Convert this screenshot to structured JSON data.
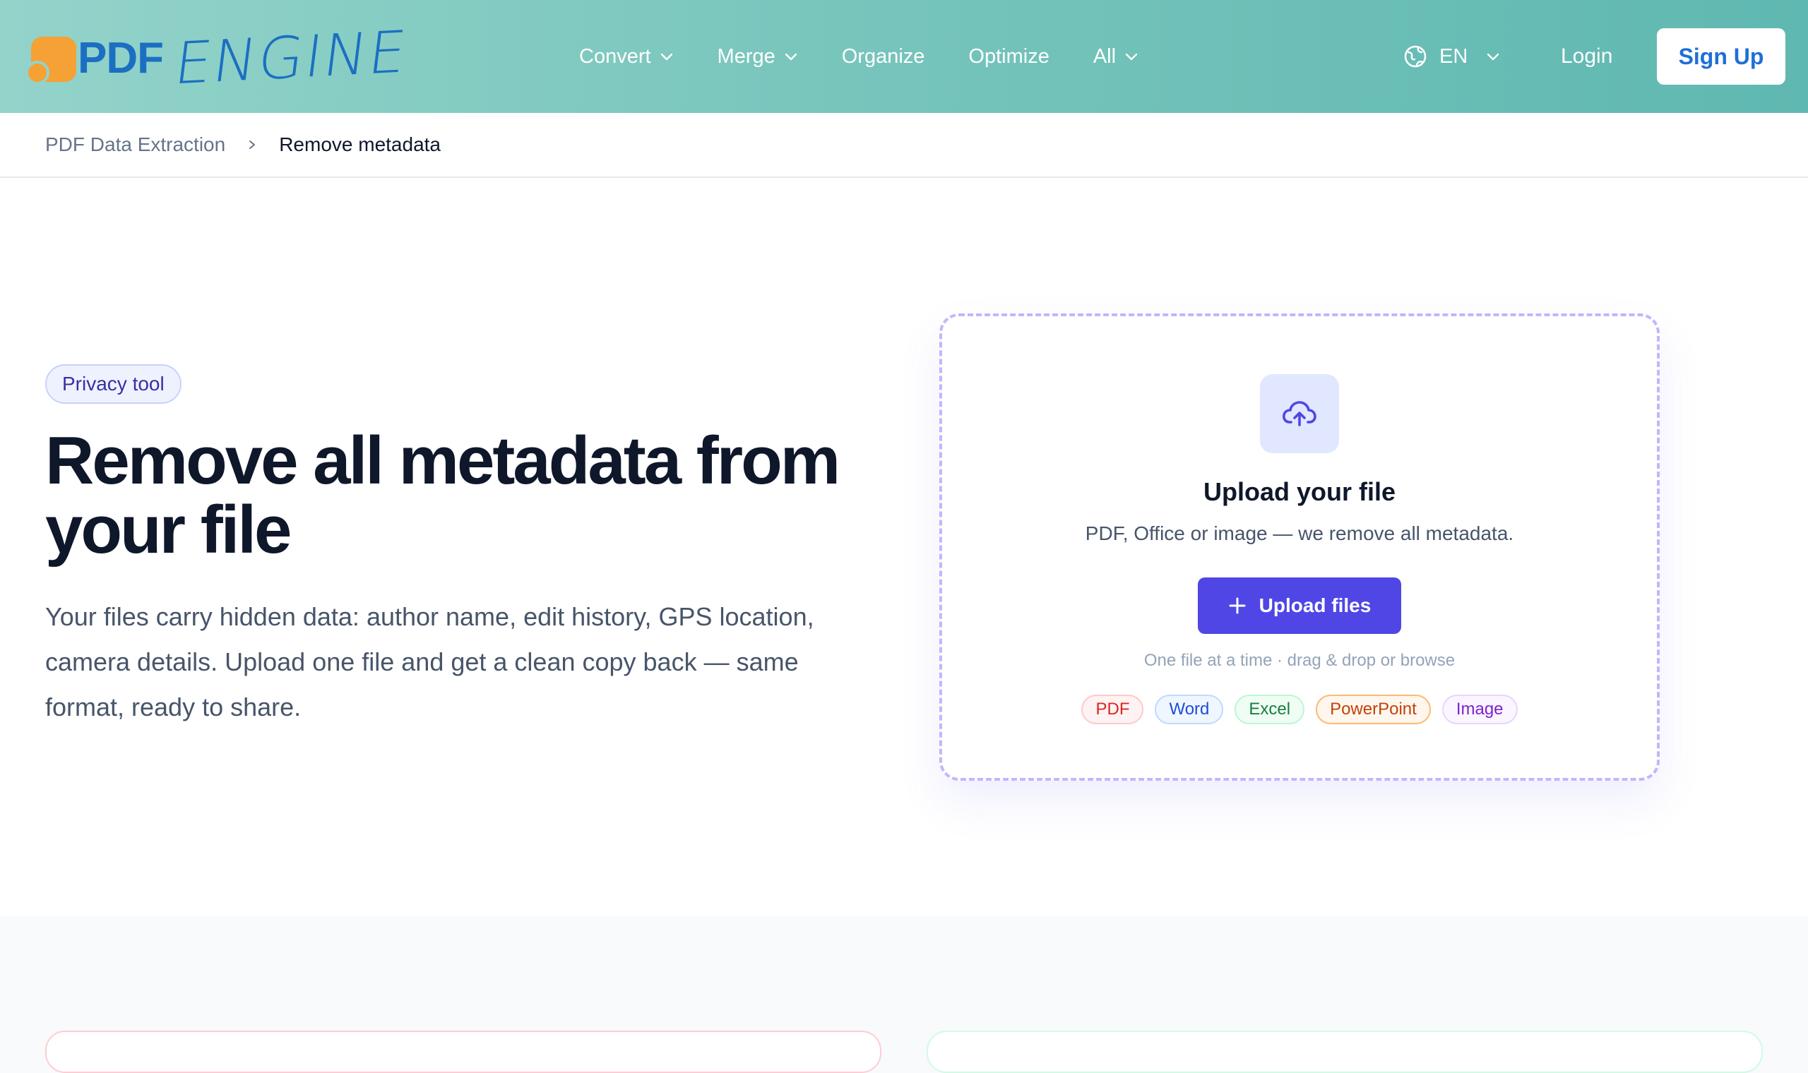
{
  "header": {
    "logo_text_bold": "PDF",
    "logo_text_script": "ENGINE",
    "nav": [
      {
        "label": "Convert",
        "has_dropdown": true
      },
      {
        "label": "Merge",
        "has_dropdown": true
      },
      {
        "label": "Organize",
        "has_dropdown": false
      },
      {
        "label": "Optimize",
        "has_dropdown": false
      },
      {
        "label": "All",
        "has_dropdown": true
      }
    ],
    "language": "EN",
    "login_label": "Login",
    "signup_label": "Sign Up"
  },
  "breadcrumb": {
    "parent": "PDF Data Extraction",
    "current": "Remove metadata"
  },
  "hero": {
    "badge": "Privacy tool",
    "title_line1": "Remove all metadata from",
    "title_line2": "your file",
    "description": "Your files carry hidden data: author name, edit history, GPS location, camera details. Upload one file and get a clean copy back — same format, ready to share."
  },
  "upload": {
    "title": "Upload your file",
    "subtitle": "PDF, Office or image — we remove all metadata.",
    "button_label": "Upload files",
    "hint": "One file at a time · drag & drop or browse",
    "formats": [
      "PDF",
      "Word",
      "Excel",
      "PowerPoint",
      "Image"
    ]
  },
  "colors": {
    "header_gradient_start": "#93d3ca",
    "header_gradient_end": "#5fb8b1",
    "brand_orange": "#f5a135",
    "brand_blue": "#1b6fc2",
    "accent": "#4f46e5",
    "signup_text": "#1f6fd6"
  }
}
